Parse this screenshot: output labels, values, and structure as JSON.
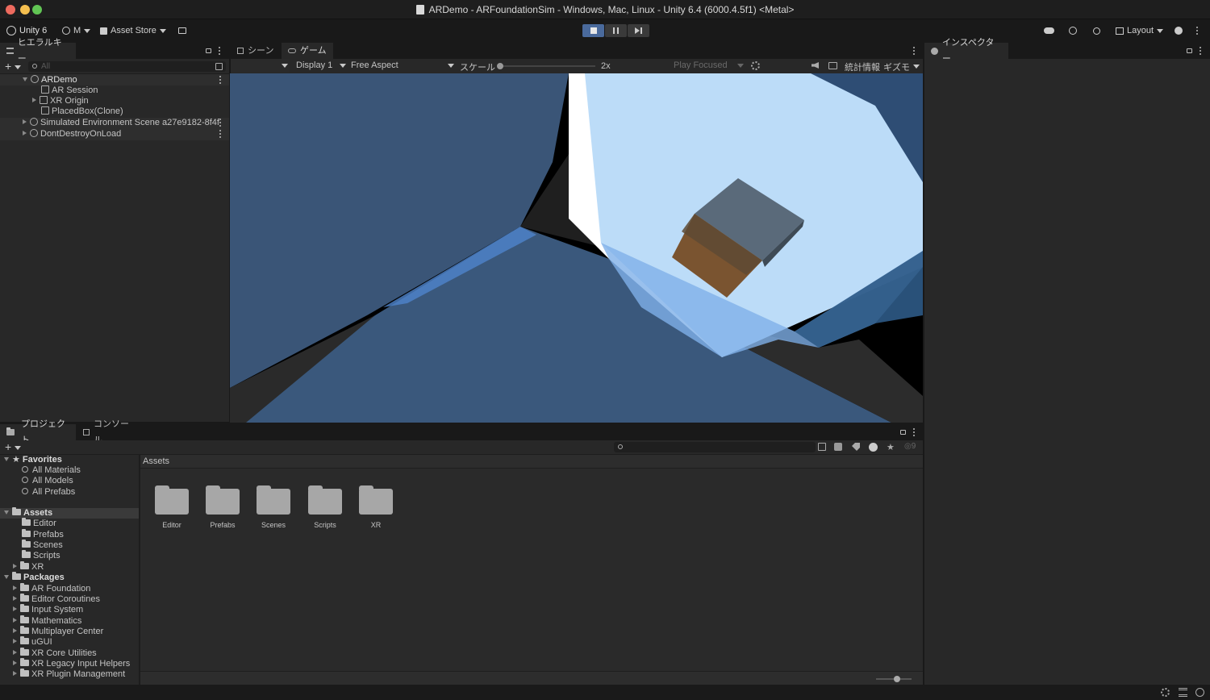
{
  "window": {
    "title": "ARDemo - ARFoundationSim - Windows, Mac, Linux - Unity 6.4 (6000.4.5f1) <Metal>"
  },
  "toolbar": {
    "unity_label": "Unity 6",
    "account_label": "M",
    "asset_store_label": "Asset Store",
    "layout_label": "Layout"
  },
  "hierarchy": {
    "tab_label": "ヒエラルキー",
    "search_placeholder": "All",
    "items": [
      {
        "label": "ARDemo"
      },
      {
        "label": "AR Session"
      },
      {
        "label": "XR Origin"
      },
      {
        "label": "PlacedBox(Clone)"
      },
      {
        "label": "Simulated Environment Scene a27e9182-8f4f"
      },
      {
        "label": "DontDestroyOnLoad"
      }
    ]
  },
  "game_view": {
    "scene_tab": "シーン",
    "game_tab": "ゲーム",
    "display": "Display 1",
    "aspect": "Free Aspect",
    "scale_label": "スケール",
    "scale_value": "2x",
    "play_mode": "Play Focused",
    "stats_label": "統計情報",
    "gizmos_label": "ギズモ"
  },
  "inspector": {
    "tab_label": "インスペクター"
  },
  "project": {
    "project_tab": "プロジェクト",
    "console_tab": "コンソール",
    "hidden_count": "9",
    "favorites_label": "Favorites",
    "favorites": [
      {
        "label": "All Materials"
      },
      {
        "label": "All Models"
      },
      {
        "label": "All Prefabs"
      }
    ],
    "assets_label": "Assets",
    "asset_folders": [
      {
        "label": "Editor"
      },
      {
        "label": "Prefabs"
      },
      {
        "label": "Scenes"
      },
      {
        "label": "Scripts"
      },
      {
        "label": "XR"
      }
    ],
    "packages_label": "Packages",
    "packages": [
      {
        "label": "AR Foundation"
      },
      {
        "label": "Editor Coroutines"
      },
      {
        "label": "Input System"
      },
      {
        "label": "Mathematics"
      },
      {
        "label": "Multiplayer Center"
      },
      {
        "label": "uGUI"
      },
      {
        "label": "XR Core Utilities"
      },
      {
        "label": "XR Legacy Input Helpers"
      },
      {
        "label": "XR Plugin Management"
      }
    ],
    "breadcrumb": "Assets",
    "grid_items": [
      {
        "label": "Editor"
      },
      {
        "label": "Prefabs"
      },
      {
        "label": "Scenes"
      },
      {
        "label": "Scripts"
      },
      {
        "label": "XR"
      }
    ]
  },
  "colors": {
    "accent_play": "#4a6a9c",
    "scene_floor": "#3a587c",
    "scene_light_plane": "#bcdcf8",
    "box_brown": "#7a5430"
  }
}
